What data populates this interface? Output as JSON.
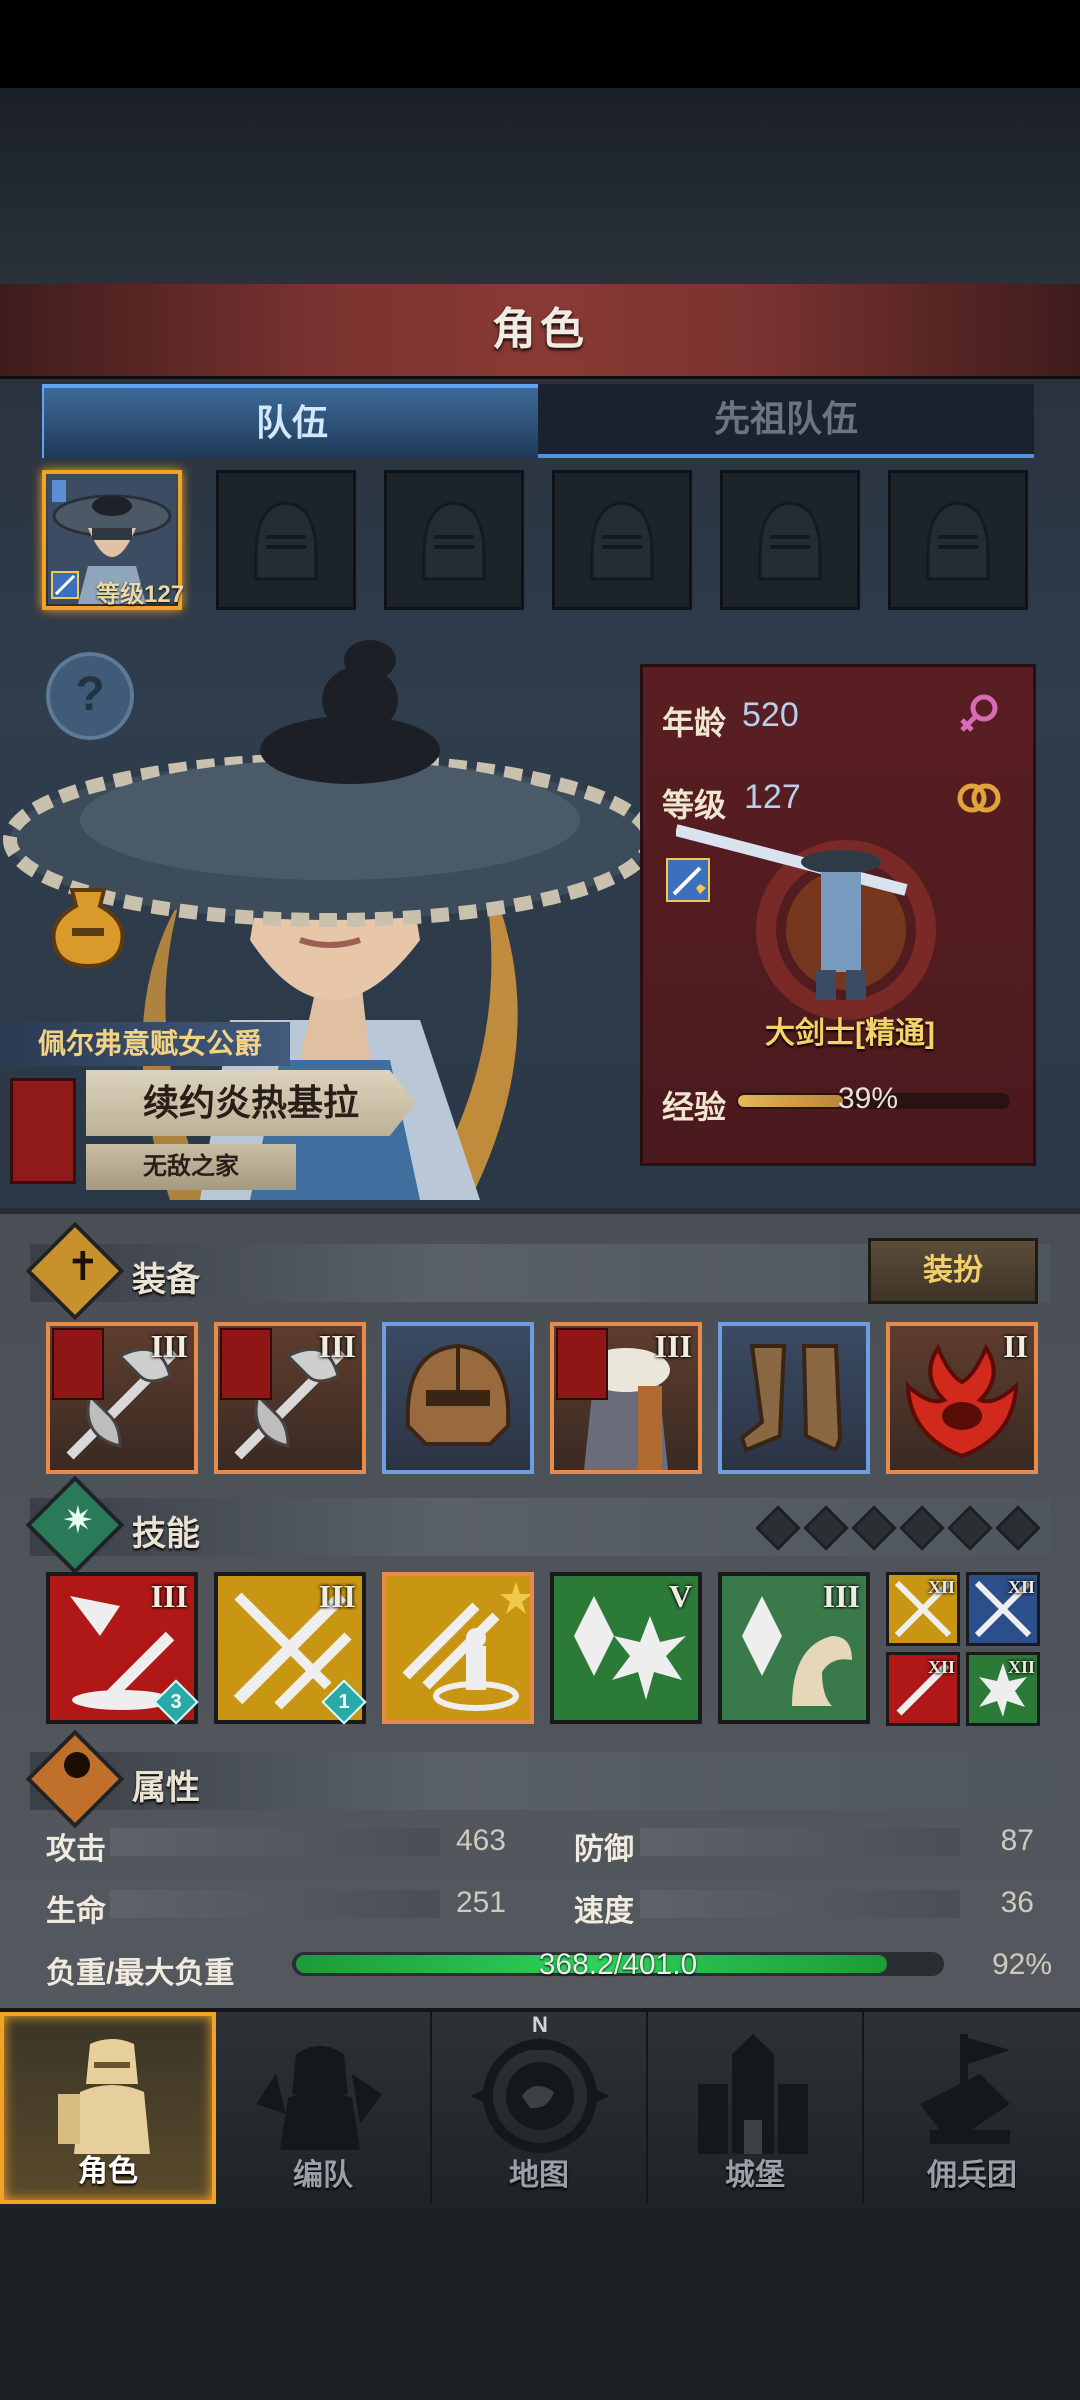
{
  "header": {
    "title": "角色"
  },
  "tabs": [
    {
      "label": "队伍",
      "active": true
    },
    {
      "label": "先祖队伍",
      "active": false
    }
  ],
  "party": {
    "selected_level_text": "等级127"
  },
  "hero": {
    "title": "佩尔弗意赋女公爵",
    "name": "续约炎热基拉",
    "guild": "无敌之家"
  },
  "info": {
    "age_label": "年龄",
    "age_value": "520",
    "level_label": "等级",
    "level_value": "127",
    "class_name": "大剑士[精通]",
    "exp_label": "经验",
    "exp_percent_text": "39%",
    "exp_fraction": 0.39
  },
  "equipment": {
    "section_title": "装备",
    "outfit_button": "装扮",
    "items": [
      {
        "icon": "axe-icon",
        "tier": "III",
        "rarity": "orange",
        "flag": true
      },
      {
        "icon": "axe-icon",
        "tier": "III",
        "rarity": "orange",
        "flag": true
      },
      {
        "icon": "helmet-icon",
        "tier": "",
        "rarity": "blue",
        "flag": false
      },
      {
        "icon": "fur-armor-icon",
        "tier": "III",
        "rarity": "orange",
        "flag": true
      },
      {
        "icon": "boots-icon",
        "tier": "",
        "rarity": "blue",
        "flag": false
      },
      {
        "icon": "phoenix-emblem-icon",
        "tier": "II",
        "rarity": "orange",
        "flag": false
      }
    ]
  },
  "skills": {
    "section_title": "技能",
    "items": [
      {
        "icon": "broken-sword-icon",
        "tier": "III",
        "badge": "3",
        "color": "#b01818"
      },
      {
        "icon": "crossed-swords-icon",
        "tier": "III",
        "badge": "1",
        "color": "#c89612"
      },
      {
        "icon": "sword-summon-icon",
        "tier": "",
        "badge": "",
        "color": "#c89612"
      },
      {
        "icon": "crystal-burst-icon",
        "tier": "V",
        "badge": "",
        "color": "#2b7a38"
      },
      {
        "icon": "crystal-arm-icon",
        "tier": "III",
        "badge": "",
        "color": "#3a7a4a"
      }
    ],
    "mini": [
      {
        "icon": "crossed-swords-icon",
        "tier": "XII",
        "color": "#c89612"
      },
      {
        "icon": "crossed-swords-icon",
        "tier": "XII",
        "color": "#2a4f8a"
      },
      {
        "icon": "sword-icon",
        "tier": "XII",
        "color": "#b01818"
      },
      {
        "icon": "burst-icon",
        "tier": "XII",
        "color": "#2b7a38"
      }
    ]
  },
  "attributes": {
    "section_title": "属性",
    "attack_label": "攻击",
    "attack_value": "463",
    "defense_label": "防御",
    "defense_value": "87",
    "hp_label": "生命",
    "hp_value": "251",
    "speed_label": "速度",
    "speed_value": "36",
    "load_label": "负重/最大负重",
    "load_text": "368.2/401.0",
    "load_percent_text": "92%",
    "load_fraction": 0.918
  },
  "nav": [
    {
      "label": "角色",
      "icon": "knight-icon",
      "active": true
    },
    {
      "label": "编队",
      "icon": "formation-icon",
      "active": false
    },
    {
      "label": "地图",
      "icon": "compass-map-icon",
      "active": false
    },
    {
      "label": "城堡",
      "icon": "castle-icon",
      "active": false
    },
    {
      "label": "佣兵团",
      "icon": "mercenary-icon",
      "active": false
    }
  ],
  "compass_letter": "N",
  "colors": {
    "accent_gold": "#f2a326",
    "tab_blue": "#5ea4f0",
    "panel_red": "#5a1e22",
    "load_green": "#2cd15a"
  }
}
